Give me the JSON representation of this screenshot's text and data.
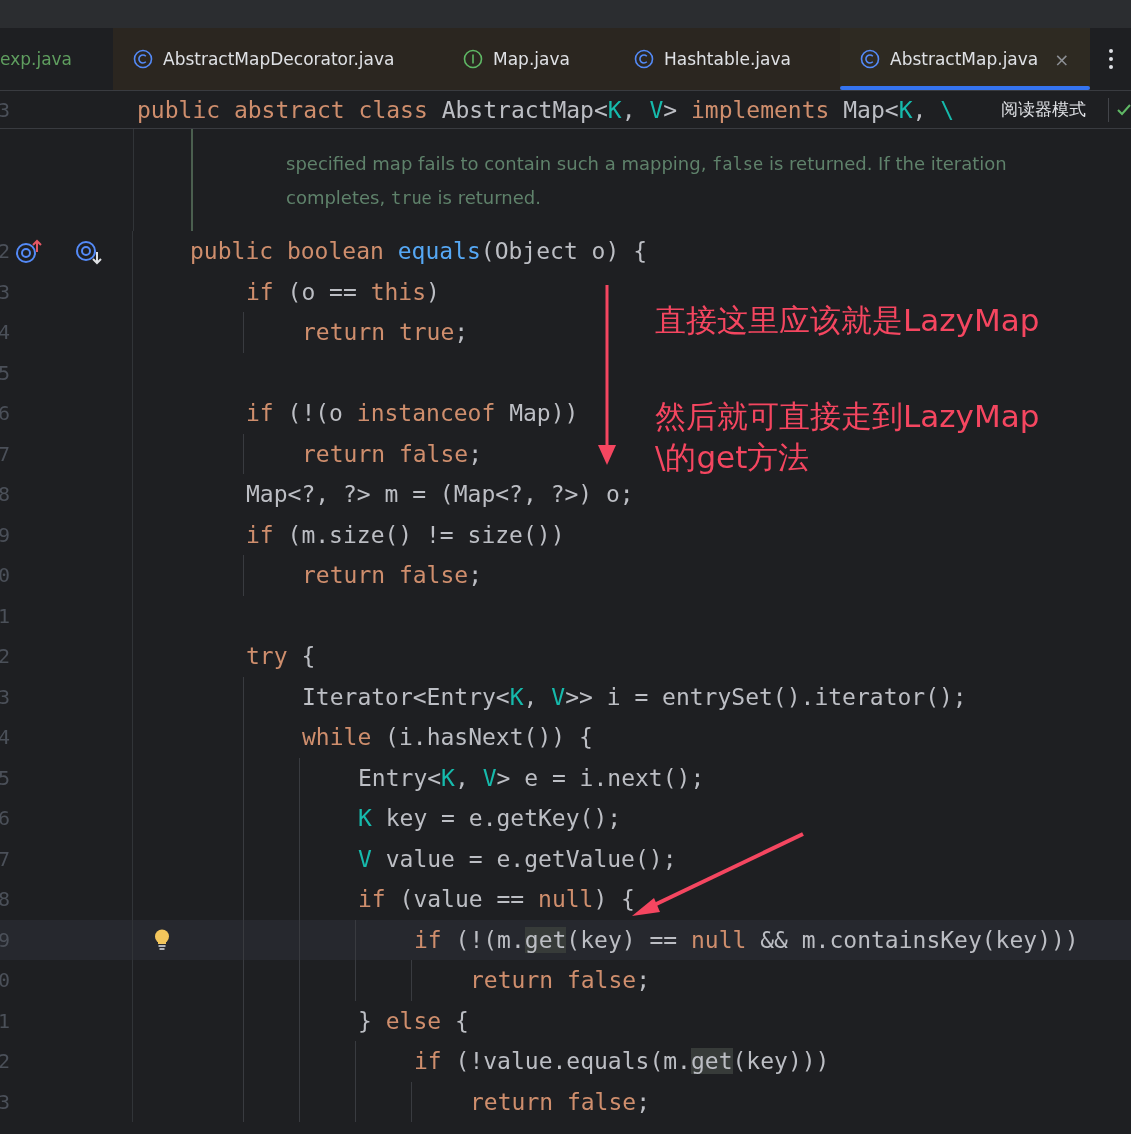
{
  "tabs": [
    {
      "label": "exp.java",
      "kind": "none",
      "color": "#5f9e5f",
      "selected": false
    },
    {
      "label": "AbstractMapDecorator.java",
      "kind": "class",
      "color": "#dfe1e5",
      "selected": false
    },
    {
      "label": "Map.java",
      "kind": "interface",
      "color": "#dfe1e5",
      "selected": false
    },
    {
      "label": "Hashtable.java",
      "kind": "class",
      "color": "#dfe1e5",
      "selected": false
    },
    {
      "label": "AbstractMap.java",
      "kind": "class",
      "color": "#dfe1e5",
      "selected": true,
      "close": "×"
    }
  ],
  "sticky_header": {
    "line_number": "3",
    "tokens": [
      {
        "kind": "kw",
        "t": "public abstract class "
      },
      {
        "kind": "plain",
        "t": "AbstractMap<"
      },
      {
        "kind": "tp",
        "t": "K"
      },
      {
        "kind": "plain",
        "t": ", "
      },
      {
        "kind": "tp",
        "t": "V"
      },
      {
        "kind": "plain",
        "t": "> "
      },
      {
        "kind": "kw",
        "t": "implements "
      },
      {
        "kind": "plain",
        "t": "Map<"
      },
      {
        "kind": "tp",
        "t": "K"
      },
      {
        "kind": "plain",
        "t": ", "
      },
      {
        "kind": "tp",
        "t": "\\"
      }
    ],
    "reader_mode": "阅读器模式"
  },
  "doc_lines": [
    [
      {
        "kind": "text",
        "t": "specified map fails to contain such a mapping, "
      },
      {
        "kind": "code",
        "t": "false"
      },
      {
        "kind": "text",
        "t": " is returned. If the iteration"
      }
    ],
    [
      {
        "kind": "text",
        "t": "completes, "
      },
      {
        "kind": "code",
        "t": "true"
      },
      {
        "kind": "text",
        "t": " is returned."
      }
    ]
  ],
  "lines": [
    {
      "number": "2",
      "kind": "code",
      "current": false,
      "gutter_icons": [
        {
          "kind": "overrides"
        },
        {
          "kind": "implemented"
        }
      ],
      "tokens": [
        {
          "kind": "kw",
          "t": "public boolean "
        },
        {
          "kind": "fn",
          "t": "equals"
        },
        {
          "kind": "plain",
          "t": "(Object o) {"
        }
      ],
      "children": [
        {
          "number": "3",
          "kind": "code",
          "current": false,
          "tokens": [
            {
              "kind": "kw",
              "t": "if "
            },
            {
              "kind": "plain",
              "t": "(o == "
            },
            {
              "kind": "kw",
              "t": "this"
            },
            {
              "kind": "plain",
              "t": ")"
            }
          ],
          "children": [
            {
              "number": "4",
              "kind": "code",
              "current": false,
              "tokens": [
                {
                  "kind": "kw",
                  "t": "return true"
                },
                {
                  "kind": "plain",
                  "t": ";"
                }
              ]
            }
          ]
        },
        {
          "number": "5",
          "kind": "blank",
          "current": false
        },
        {
          "number": "6",
          "kind": "code",
          "current": false,
          "tokens": [
            {
              "kind": "kw",
              "t": "if "
            },
            {
              "kind": "plain",
              "t": "(!(o "
            },
            {
              "kind": "kw",
              "t": "instanceof "
            },
            {
              "kind": "plain",
              "t": "Map))"
            }
          ],
          "children": [
            {
              "number": "7",
              "kind": "code",
              "current": false,
              "tokens": [
                {
                  "kind": "kw",
                  "t": "return false"
                },
                {
                  "kind": "plain",
                  "t": ";"
                }
              ]
            }
          ]
        },
        {
          "number": "8",
          "kind": "code",
          "current": false,
          "tokens": [
            {
              "kind": "plain",
              "t": "Map<?, ?> m = (Map<?, ?>) o;"
            }
          ]
        },
        {
          "number": "9",
          "kind": "code",
          "current": false,
          "tokens": [
            {
              "kind": "kw",
              "t": "if "
            },
            {
              "kind": "plain",
              "t": "(m.size() != size())"
            }
          ],
          "children": [
            {
              "number": "0",
              "kind": "code",
              "current": false,
              "tokens": [
                {
                  "kind": "kw",
                  "t": "return false"
                },
                {
                  "kind": "plain",
                  "t": ";"
                }
              ]
            }
          ]
        },
        {
          "number": "1",
          "kind": "blank",
          "current": false
        },
        {
          "number": "2",
          "kind": "code",
          "current": false,
          "tokens": [
            {
              "kind": "kw",
              "t": "try "
            },
            {
              "kind": "plain",
              "t": "{"
            }
          ],
          "children": [
            {
              "number": "3",
              "kind": "code",
              "current": false,
              "tokens": [
                {
                  "kind": "plain",
                  "t": "Iterator<Entry<"
                },
                {
                  "kind": "tp",
                  "t": "K"
                },
                {
                  "kind": "plain",
                  "t": ", "
                },
                {
                  "kind": "tp",
                  "t": "V"
                },
                {
                  "kind": "plain",
                  "t": ">> i = entrySet().iterator();"
                }
              ]
            },
            {
              "number": "4",
              "kind": "code",
              "current": false,
              "tokens": [
                {
                  "kind": "kw",
                  "t": "while "
                },
                {
                  "kind": "plain",
                  "t": "(i.hasNext()) {"
                }
              ],
              "children": [
                {
                  "number": "5",
                  "kind": "code",
                  "current": false,
                  "tokens": [
                    {
                      "kind": "plain",
                      "t": "Entry<"
                    },
                    {
                      "kind": "tp",
                      "t": "K"
                    },
                    {
                      "kind": "plain",
                      "t": ", "
                    },
                    {
                      "kind": "tp",
                      "t": "V"
                    },
                    {
                      "kind": "plain",
                      "t": "> e = i.next();"
                    }
                  ]
                },
                {
                  "number": "6",
                  "kind": "code",
                  "current": false,
                  "tokens": [
                    {
                      "kind": "tp",
                      "t": "K "
                    },
                    {
                      "kind": "plain",
                      "t": "key = e.getKey();"
                    }
                  ]
                },
                {
                  "number": "7",
                  "kind": "code",
                  "current": false,
                  "tokens": [
                    {
                      "kind": "tp",
                      "t": "V "
                    },
                    {
                      "kind": "plain",
                      "t": "value = e.getValue();"
                    }
                  ]
                },
                {
                  "number": "8",
                  "kind": "code",
                  "current": false,
                  "tokens": [
                    {
                      "kind": "kw",
                      "t": "if "
                    },
                    {
                      "kind": "plain",
                      "t": "(value == "
                    },
                    {
                      "kind": "kw",
                      "t": "null"
                    },
                    {
                      "kind": "plain",
                      "t": ") {"
                    }
                  ],
                  "children": [
                    {
                      "number": "9",
                      "kind": "code",
                      "current": true,
                      "gutter_icons": [
                        {
                          "kind": "bulb"
                        }
                      ],
                      "tokens": [
                        {
                          "kind": "kw",
                          "t": "if "
                        },
                        {
                          "kind": "plain",
                          "t": "(!(m."
                        },
                        {
                          "kind": "hl",
                          "t": "get"
                        },
                        {
                          "kind": "plain",
                          "t": "(key) == "
                        },
                        {
                          "kind": "kw",
                          "t": "null "
                        },
                        {
                          "kind": "plain",
                          "t": "&& m.containsKey(key)))"
                        }
                      ],
                      "children": [
                        {
                          "number": "0",
                          "kind": "code",
                          "current": false,
                          "tokens": [
                            {
                              "kind": "kw",
                              "t": "return false"
                            },
                            {
                              "kind": "plain",
                              "t": ";"
                            }
                          ]
                        }
                      ]
                    }
                  ]
                },
                {
                  "number": "1",
                  "kind": "code",
                  "current": false,
                  "tokens": [
                    {
                      "kind": "plain",
                      "t": "} "
                    },
                    {
                      "kind": "kw",
                      "t": "else "
                    },
                    {
                      "kind": "plain",
                      "t": "{"
                    }
                  ],
                  "children": [
                    {
                      "number": "2",
                      "kind": "code",
                      "current": false,
                      "tokens": [
                        {
                          "kind": "kw",
                          "t": "if "
                        },
                        {
                          "kind": "plain",
                          "t": "(!value.equals(m."
                        },
                        {
                          "kind": "hl",
                          "t": "get"
                        },
                        {
                          "kind": "plain",
                          "t": "(key)))"
                        }
                      ],
                      "children": [
                        {
                          "number": "3",
                          "kind": "code",
                          "current": false,
                          "tokens": [
                            {
                              "kind": "kw",
                              "t": "return false"
                            },
                            {
                              "kind": "plain",
                              "t": ";"
                            }
                          ]
                        }
                      ]
                    }
                  ]
                }
              ]
            }
          ]
        }
      ]
    }
  ],
  "annotations": [
    "直接这里应该就是LazyMap",
    "然后就可直接走到LazyMap",
    "\\的get方法"
  ]
}
